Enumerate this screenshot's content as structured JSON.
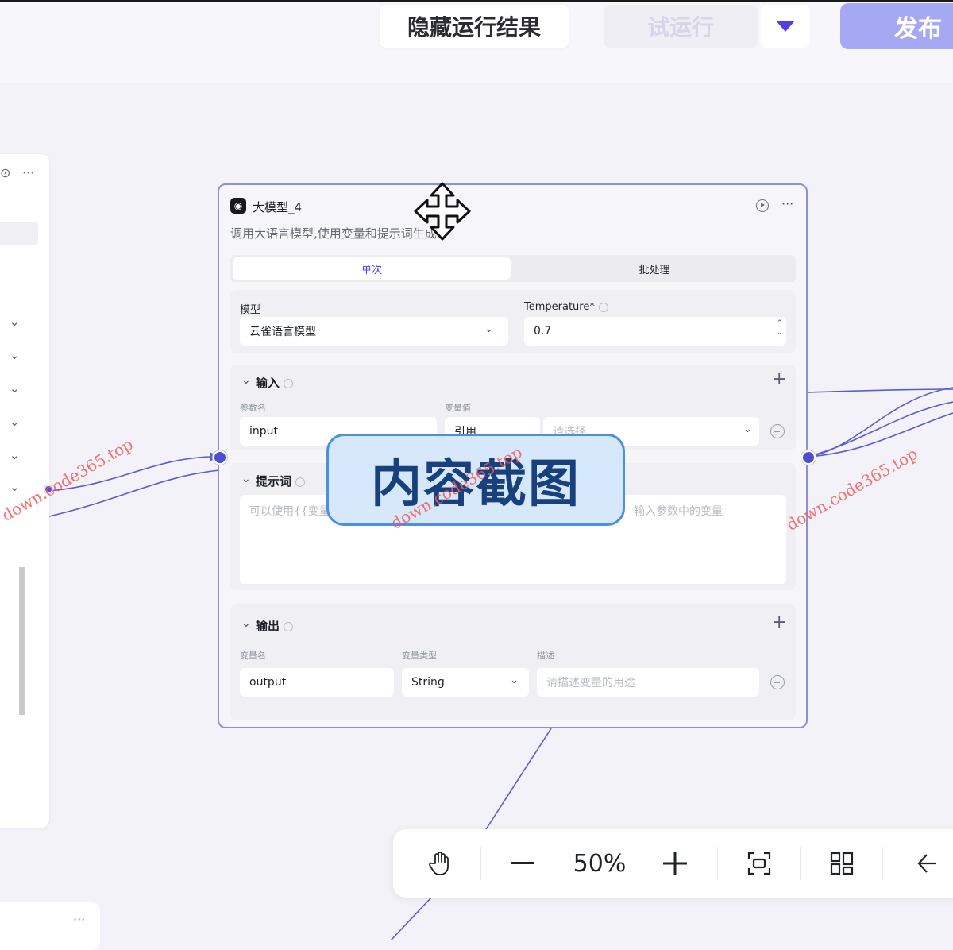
{
  "topbar": {
    "hide_results_label": "隐藏运行结果",
    "test_run_label": "试运行",
    "publish_label": "发布"
  },
  "node": {
    "title": "大模型_4",
    "description": "调用大语言模型,使用变量和提示词生成",
    "tabs": [
      {
        "label": "单次"
      },
      {
        "label": "批处理"
      }
    ],
    "model_label": "模型",
    "model_value": "云雀语言模型",
    "temperature_label": "Temperature*",
    "temperature_value": "0.7",
    "input": {
      "title": "输入",
      "param_name_header": "参数名",
      "var_value_header": "变量值",
      "param_name": "input",
      "ref_type": "引用",
      "select_placeholder": "请选择"
    },
    "prompt": {
      "title": "提示词",
      "placeholder_left": "可以使用{{变量",
      "placeholder_right": "输入参数中的变量"
    },
    "output": {
      "title": "输出",
      "var_name_header": "变量名",
      "var_type_header": "变量类型",
      "desc_header": "描述",
      "var_name": "output",
      "var_type": "String",
      "desc_placeholder": "请描述变量的用途"
    }
  },
  "overlay": {
    "text": "内容截图"
  },
  "watermark": {
    "text": "down.code365.top"
  },
  "toolbar": {
    "zoom_value": "50%"
  },
  "icons": [
    "play-icon",
    "more-icon",
    "chevron-down-icon",
    "plus-icon",
    "minus-circle-icon",
    "hand-icon",
    "zoom-out-icon",
    "zoom-in-icon",
    "fit-view-icon",
    "layout-icon",
    "collapse-icon",
    "move-cursor-icon"
  ],
  "colors": {
    "accent": "#4e4fd0",
    "publish_bg": "#a6a8f4",
    "node_border": "#8e8fd8",
    "overlay_border": "#4a8fe0"
  }
}
